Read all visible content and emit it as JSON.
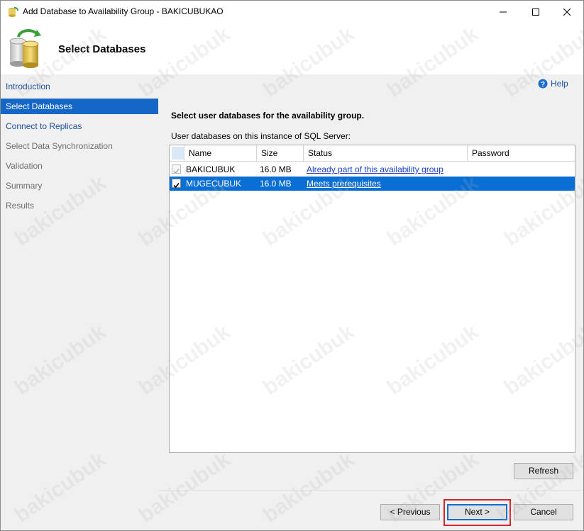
{
  "window": {
    "title": "Add Database to Availability Group - BAKICUBUKAO"
  },
  "header": {
    "title": "Select Databases"
  },
  "nav": {
    "items": [
      {
        "label": "Introduction",
        "state": "link"
      },
      {
        "label": "Select Databases",
        "state": "active"
      },
      {
        "label": "Connect to Replicas",
        "state": "link"
      },
      {
        "label": "Select Data Synchronization",
        "state": "disabled"
      },
      {
        "label": "Validation",
        "state": "disabled"
      },
      {
        "label": "Summary",
        "state": "disabled"
      },
      {
        "label": "Results",
        "state": "disabled"
      }
    ]
  },
  "content": {
    "help_label": "Help",
    "section_title": "Select user databases for the availability group.",
    "list_caption": "User databases on this instance of SQL Server:",
    "columns": [
      "Name",
      "Size",
      "Status",
      "Password"
    ],
    "rows": [
      {
        "name": "BAKICUBUK",
        "size": "16.0 MB",
        "status": "Already part of this availability group",
        "password": "",
        "checked": true,
        "enabled": false,
        "selected": false
      },
      {
        "name": "MUGECUBUK",
        "size": "16.0 MB",
        "status": "Meets prerequisites",
        "password": "",
        "checked": true,
        "enabled": true,
        "selected": true
      }
    ]
  },
  "buttons": {
    "refresh": "Refresh",
    "previous": "< Previous",
    "next": "Next >",
    "cancel": "Cancel"
  },
  "watermark_text": "bakicubuk",
  "colors": {
    "selection": "#0a6fd5",
    "nav_active": "#1467c7",
    "link": "#1c4e9c",
    "highlight_box": "#d9232a"
  }
}
